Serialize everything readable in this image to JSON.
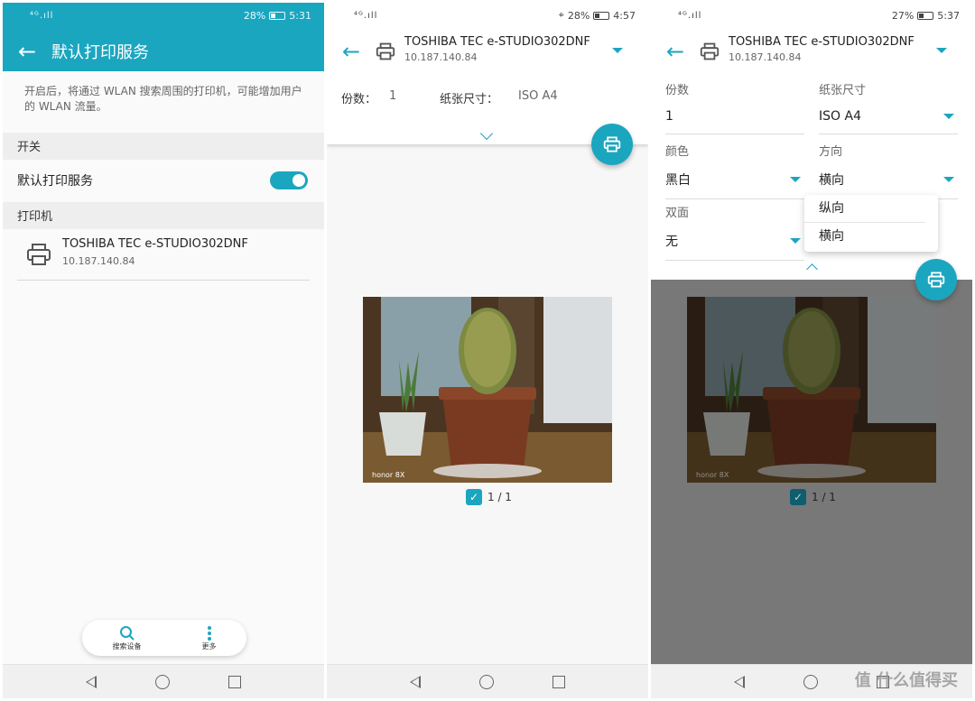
{
  "colors": {
    "accent": "#1ba6c0",
    "dim": "#787878"
  },
  "panel1": {
    "status": {
      "signal": "⁴ᴳ.ıll",
      "battery": "28%",
      "time": "5:31"
    },
    "title": "默认打印服务",
    "description": "开启后，将通过 WLAN 搜索周围的打印机，可能增加用户的 WLAN 流量。",
    "switch_section": "开关",
    "switch_label": "默认打印服务",
    "switch_on": true,
    "printer_section": "打印机",
    "printer": {
      "name": "TOSHIBA TEC e-STUDIO302DNF",
      "ip": "10.187.140.84"
    },
    "bottom_actions": [
      {
        "label": "搜索设备",
        "icon": "search-icon"
      },
      {
        "label": "更多",
        "icon": "more-icon"
      }
    ]
  },
  "panel2": {
    "status": {
      "signal": "⁴ᴳ.ıll",
      "battery": "28%",
      "time": "4:57"
    },
    "printer": {
      "name": "TOSHIBA TEC e-STUDIO302DNF",
      "ip": "10.187.140.84"
    },
    "copies_label": "份数：",
    "copies_value": "1",
    "paper_label": "纸张尺寸：",
    "paper_value": "ISO A4",
    "page_count": "1 / 1"
  },
  "panel3": {
    "status": {
      "signal": "⁴ᴳ.ıll",
      "battery": "27%",
      "time": "5:37"
    },
    "printer": {
      "name": "TOSHIBA TEC e-STUDIO302DNF",
      "ip": "10.187.140.84"
    },
    "copies": {
      "label": "份数",
      "value": "1"
    },
    "paper": {
      "label": "纸张尺寸",
      "value": "ISO A4"
    },
    "color": {
      "label": "颜色",
      "value": "黑白"
    },
    "orientation": {
      "label": "方向",
      "value": "横向"
    },
    "duplex": {
      "label": "双面",
      "value": "无"
    },
    "orientation_options": [
      "纵向",
      "横向"
    ],
    "page_count": "1 / 1"
  },
  "photo_caption": "honor 8X",
  "watermark": "值 什么值得买"
}
